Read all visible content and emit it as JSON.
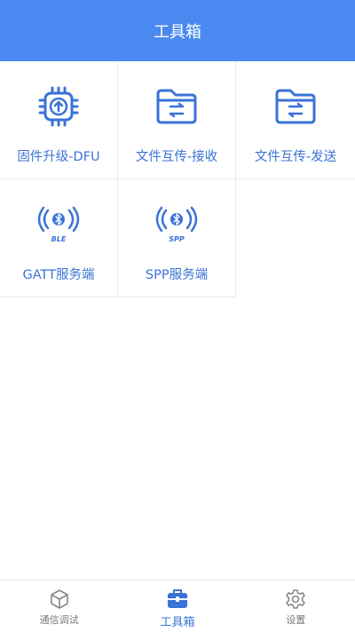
{
  "header": {
    "title": "工具箱"
  },
  "tools": [
    {
      "label": "固件升级-DFU",
      "icon": "chip-upload-icon"
    },
    {
      "label": "文件互传-接收",
      "icon": "folder-transfer-icon"
    },
    {
      "label": "文件互传-发送",
      "icon": "folder-transfer-icon"
    },
    {
      "label": "GATT服务端",
      "icon": "bluetooth-signal-icon",
      "badge": "BLE"
    },
    {
      "label": "SPP服务端",
      "icon": "bluetooth-signal-icon",
      "badge": "SPP"
    }
  ],
  "tabs": [
    {
      "label": "通信调试",
      "icon": "cube-icon",
      "active": false
    },
    {
      "label": "工具箱",
      "icon": "toolbox-icon",
      "active": true
    },
    {
      "label": "设置",
      "icon": "gear-icon",
      "active": false
    }
  ],
  "colors": {
    "accent": "#4a8af0",
    "label": "#3a73d6",
    "divider": "#e9eaec",
    "inactive": "#777777"
  }
}
